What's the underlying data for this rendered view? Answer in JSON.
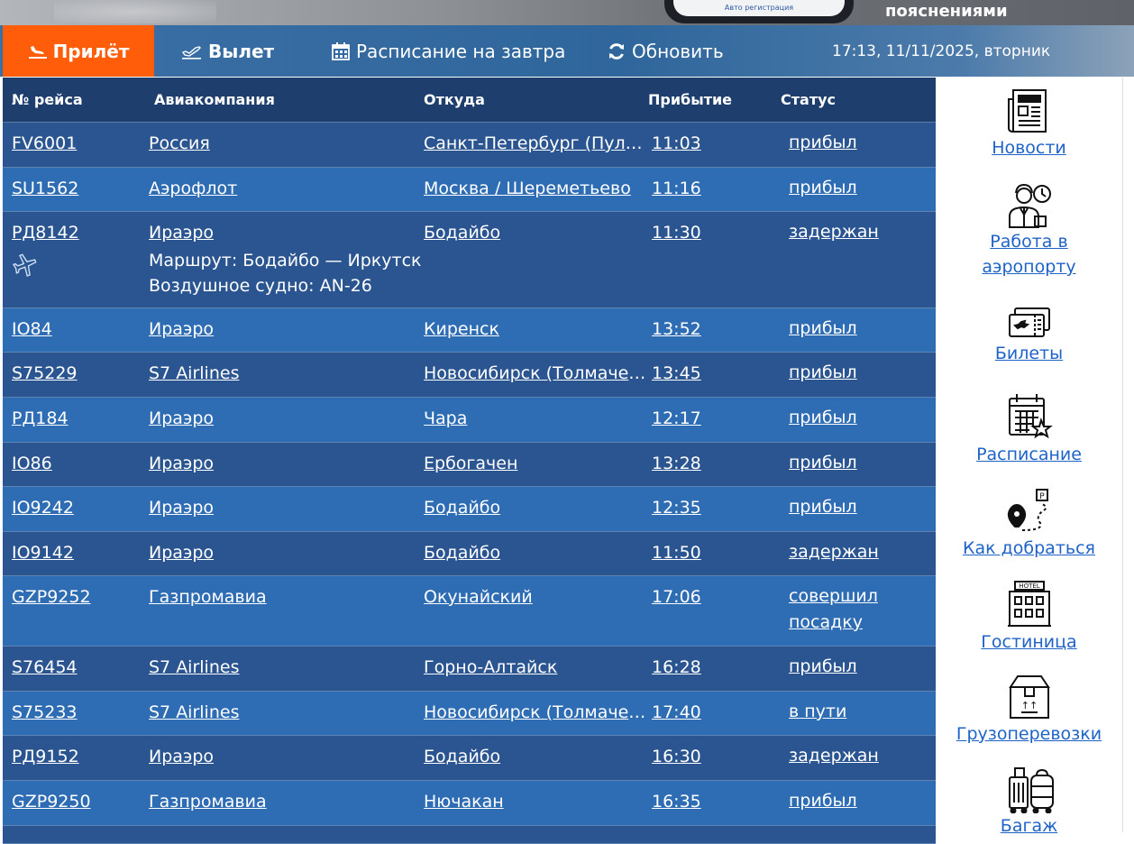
{
  "banner": {
    "phone_caption": "Авто регистрация",
    "text": "пояснениями"
  },
  "nav": {
    "arrivals": "Прилёт",
    "departures": "Вылет",
    "tomorrow": "Расписание на завтра",
    "refresh": "Обновить",
    "datetime": "17:13, 11/11/2025, вторник",
    "accent_color": "#ff5d0a"
  },
  "table": {
    "headers": {
      "flight": "№ рейса",
      "airline": "Авиакомпания",
      "from": "Откуда",
      "arrival": "Прибытие",
      "status": "Статус"
    },
    "rows": [
      {
        "flight": "FV6001",
        "airline": "Россия",
        "from": "Санкт-Петербург (Пулково)",
        "arrival": "11:03",
        "status": "прибыл"
      },
      {
        "flight": "SU1562",
        "airline": "Аэрофлот",
        "from": "Москва / Шереметьево",
        "arrival": "11:16",
        "status": "прибыл"
      },
      {
        "flight": "РД8142",
        "airline": "Ираэро",
        "from": "Бодайбо",
        "arrival": "11:30",
        "status": "задержан",
        "route": "Маршрут: Бодайбо — Иркутск",
        "aircraft": "Воздушное судно: AN-26"
      },
      {
        "flight": "IO84",
        "airline": "Ираэро",
        "from": "Киренск",
        "arrival": "13:52",
        "status": "прибыл"
      },
      {
        "flight": "S75229",
        "airline": "S7 Airlines",
        "from": "Новосибирск (Толмачево)",
        "arrival": "13:45",
        "status": "прибыл"
      },
      {
        "flight": "РД184",
        "airline": "Ираэро",
        "from": "Чара",
        "arrival": "12:17",
        "status": "прибыл"
      },
      {
        "flight": "IO86",
        "airline": "Ираэро",
        "from": "Ербогачен",
        "arrival": "13:28",
        "status": "прибыл"
      },
      {
        "flight": "IO9242",
        "airline": "Ираэро",
        "from": "Бодайбо",
        "arrival": "12:35",
        "status": "прибыл"
      },
      {
        "flight": "IO9142",
        "airline": "Ираэро",
        "from": "Бодайбо",
        "arrival": "11:50",
        "status": "задержан"
      },
      {
        "flight": "GZP9252",
        "airline": "Газпромавиа",
        "from": "Окунайский",
        "arrival": "17:06",
        "status": "совершил посадку"
      },
      {
        "flight": "S76454",
        "airline": "S7 Airlines",
        "from": "Горно-Алтайск",
        "arrival": "16:28",
        "status": "прибыл"
      },
      {
        "flight": "S75233",
        "airline": "S7 Airlines",
        "from": "Новосибирск (Толмачево)",
        "arrival": "17:40",
        "status": "в пути"
      },
      {
        "flight": "РД9152",
        "airline": "Ираэро",
        "from": "Бодайбо",
        "arrival": "16:30",
        "status": "задержан"
      },
      {
        "flight": "GZP9250",
        "airline": "Газпромавиа",
        "from": "Нючакан",
        "arrival": "16:35",
        "status": "прибыл"
      }
    ]
  },
  "sidebar": {
    "items": [
      {
        "label": "Новости",
        "icon": "newspaper-icon"
      },
      {
        "label": "Работа в аэропорту",
        "icon": "worker-clock-icon"
      },
      {
        "label": "Билеты",
        "icon": "tickets-icon"
      },
      {
        "label": "Расписание",
        "icon": "calendar-star-icon"
      },
      {
        "label": "Как добраться",
        "icon": "map-pin-parking-icon"
      },
      {
        "label": "Гостиница",
        "icon": "hotel-icon"
      },
      {
        "label": "Грузоперевозки",
        "icon": "cargo-box-icon"
      },
      {
        "label": "Багаж",
        "icon": "luggage-icon"
      }
    ],
    "icon_text": {
      "parking": "P",
      "hotel": "HOTEL",
      "box_arrows": "↑↑"
    },
    "link_color": "#1f63c8"
  }
}
